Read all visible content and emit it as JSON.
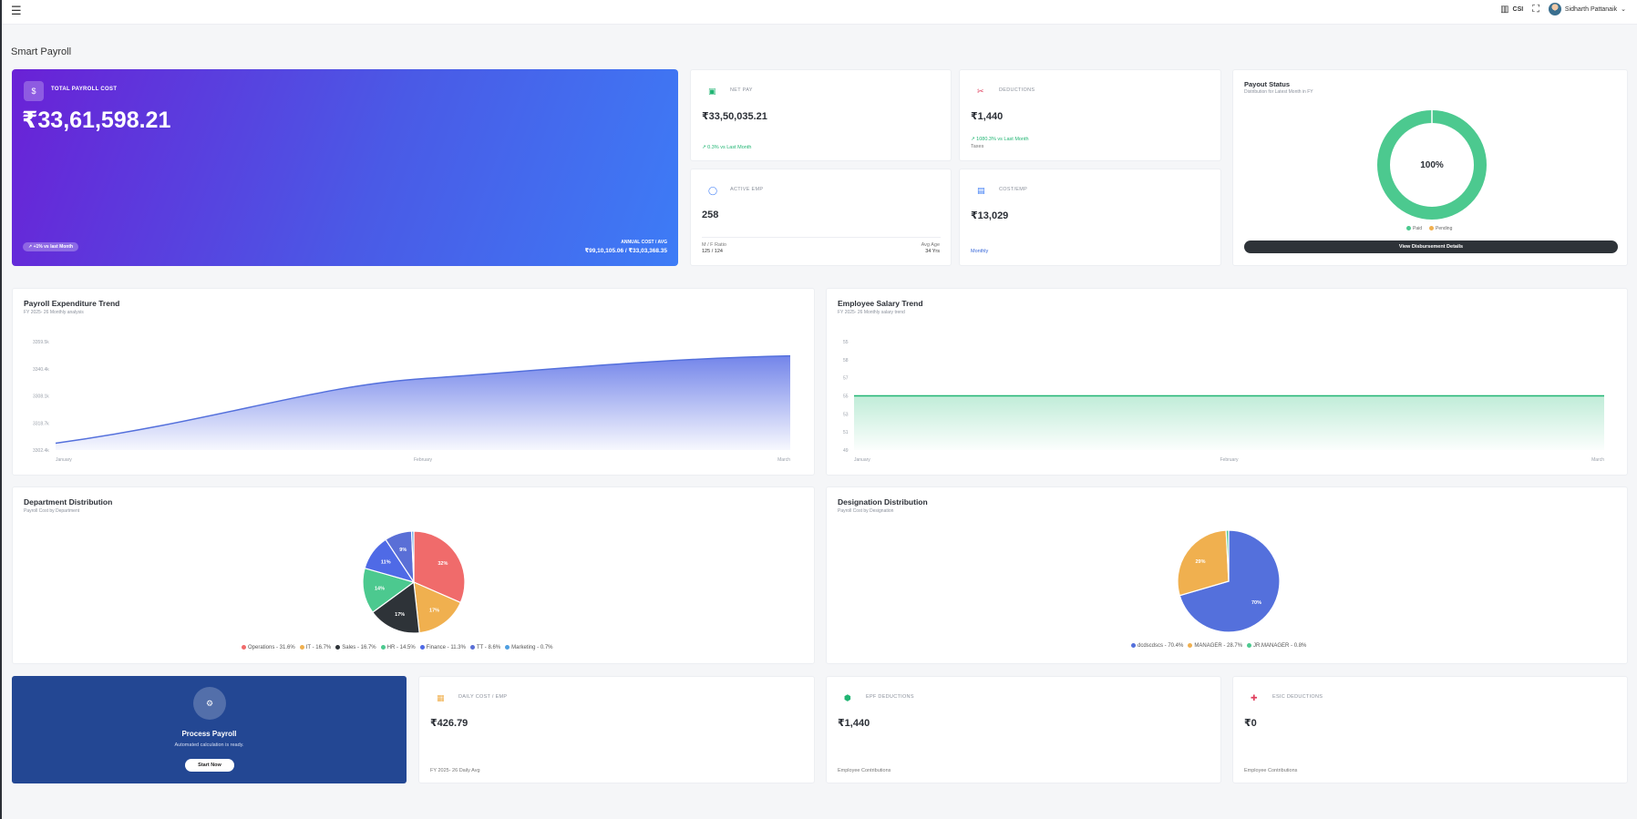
{
  "topbar": {
    "menu_icon": "hamburger-icon",
    "company": "CSI",
    "user_name": "Sidharth Pattanaik"
  },
  "page": {
    "title": "Smart Payroll"
  },
  "hero": {
    "label": "TOTAL PAYROLL COST",
    "amount": "₹33,61,598.21",
    "trend": "+1% vs last Month",
    "annual_label": "ANNUAL COST / AVG",
    "annual_value": "₹99,10,105.06 / ₹33,03,368.35"
  },
  "net_pay": {
    "label": "NET PAY",
    "value": "₹33,50,035.21",
    "trend": "0.3% vs Last Month"
  },
  "deductions": {
    "label": "DEDUCTIONS",
    "value": "₹1,440",
    "trend": "1080.3% vs Last Month",
    "note": "Taxes"
  },
  "active_emp": {
    "label": "ACTIVE EMP",
    "value": "258",
    "ratio_label": "M / F Ratio",
    "ratio_value": "125 / 124",
    "age_label": "Avg Age",
    "age_value": "34 Yrs"
  },
  "cost_emp": {
    "label": "COST/EMP",
    "value": "₹13,029",
    "note": "Monthly"
  },
  "payout": {
    "title": "Payout Status",
    "desc": "Distribution for Latest Month in FY",
    "center": "100%",
    "paid_pct": 100,
    "legend": [
      "Paid",
      "Pending"
    ],
    "button": "View Disbursement Details"
  },
  "expenditure": {
    "title": "Payroll Expenditure Trend",
    "desc": "FY 2025- 26 Monthly analysis",
    "y_ticks": [
      "3359.5k",
      "3340.4k",
      "3308.1k",
      "3318.7k",
      "3302.4k"
    ],
    "x_ticks": [
      "January",
      "February",
      "March"
    ]
  },
  "salary": {
    "title": "Employee Salary Trend",
    "desc": "FY 2025- 26 Monthly salary trend",
    "y_ticks": [
      "55",
      "58",
      "57",
      "55",
      "53",
      "51",
      "49"
    ],
    "x_ticks": [
      "January",
      "February",
      "March"
    ]
  },
  "department": {
    "title": "Department Distribution",
    "desc": "Payroll Cost by Department",
    "legend": [
      "Operations - 31.6%",
      "IT - 16.7%",
      "Sales - 16.7%",
      "HR - 14.5%",
      "Finance - 11.3%",
      "TT - 8.6%",
      "Marketing - 0.7%"
    ],
    "labels": [
      "32%",
      "17%",
      "17%",
      "14%",
      "11%",
      "9%"
    ]
  },
  "designation": {
    "title": "Designation Distribution",
    "desc": "Payroll Cost by Designation",
    "legend": [
      "dcdscdscs - 70.4%",
      "MANAGER - 28.7%",
      "JR.MANAGER - 0.8%"
    ],
    "labels": [
      "70%",
      "29%"
    ]
  },
  "process": {
    "icon": "settings-icon",
    "title": "Process Payroll",
    "subtitle": "Automated calculation is ready.",
    "button": "Start Now"
  },
  "daily_cost": {
    "label": "DAILY COST / EMP",
    "value": "₹426.79",
    "note": "FY 2025- 26 Daily Avg"
  },
  "epf": {
    "label": "EPF DEDUCTIONS",
    "value": "₹1,440",
    "note": "Employee Contributions"
  },
  "esic": {
    "label": "ESIC DEDUCTIONS",
    "value": "₹0",
    "note": "Employee Contributions"
  },
  "colors": {
    "operations": "#f06b6b",
    "it": "#f0b04f",
    "sales": "#2e3338",
    "hr": "#4cc98f",
    "finance": "#4f6ae6",
    "tt": "#5a6fd6",
    "marketing": "#4f9fe0",
    "dcdscdscs": "#5470dc",
    "manager": "#f0b04f",
    "jr_manager": "#4cc98f"
  },
  "chart_data": [
    {
      "type": "area",
      "title": "Payroll Expenditure Trend",
      "x": [
        "January",
        "February",
        "March"
      ],
      "series": [
        {
          "values": [
            3306.0,
            3340.0,
            3352.0
          ]
        }
      ],
      "ylim": [
        3302.4,
        3359.5
      ]
    },
    {
      "type": "line",
      "title": "Employee Salary Trend",
      "x": [
        "January",
        "February",
        "March"
      ],
      "series": [
        {
          "values": [
            55,
            55,
            55
          ]
        }
      ]
    },
    {
      "type": "pie",
      "title": "Department Distribution",
      "categories": [
        "Operations",
        "IT",
        "Sales",
        "HR",
        "Finance",
        "TT",
        "Marketing"
      ],
      "values": [
        31.6,
        16.7,
        16.7,
        14.5,
        11.3,
        8.6,
        0.7
      ]
    },
    {
      "type": "pie",
      "title": "Designation Distribution",
      "categories": [
        "dcdscdscs",
        "MANAGER",
        "JR.MANAGER"
      ],
      "values": [
        70.4,
        28.7,
        0.8
      ]
    }
  ]
}
